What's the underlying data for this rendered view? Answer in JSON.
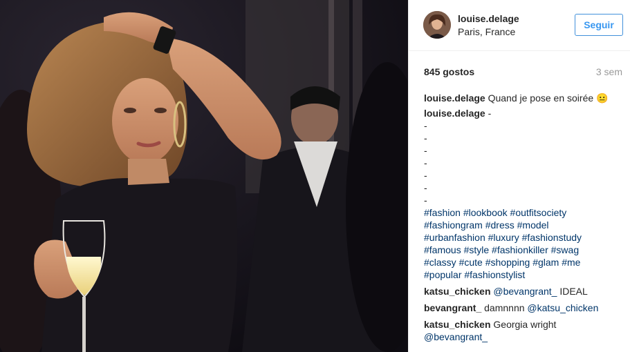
{
  "post": {
    "username": "louise.delage",
    "location": "Paris, France",
    "follow_label": "Seguir",
    "likes": "845 gostos",
    "time": "3 sem"
  },
  "caption": {
    "username": "louise.delage",
    "text": "Quand je pose en soirée",
    "emoji": "😐"
  },
  "second": {
    "username": "louise.delage",
    "text": "-",
    "dashes": [
      "-",
      "-",
      "-",
      "-",
      "-",
      "-",
      "-"
    ]
  },
  "hashtags": {
    "line1": "#fashion #lookbook #outfitsociety",
    "line2": "#fashiongram #dress #model",
    "line3": "#urbanfashion #luxury #fashionstudy",
    "line4": "#famous #style #fashionkiller #swag",
    "line5": "#classy #cute #shopping #glam #me",
    "line6": "#popular #fashionstylist"
  },
  "comments": [
    {
      "user": "katsu_chicken",
      "mention": "@bevangrant_",
      "text": "IDEAL"
    },
    {
      "user": "bevangrant_",
      "text": "damnnnn",
      "mention": "@katsu_chicken"
    },
    {
      "user": "katsu_chicken",
      "text": "Georgia wright"
    },
    {
      "partial_mention": "@bevangrant_"
    }
  ],
  "colors": {
    "follow_blue": "#3897f0",
    "link_blue": "#003569",
    "muted": "#999999"
  }
}
